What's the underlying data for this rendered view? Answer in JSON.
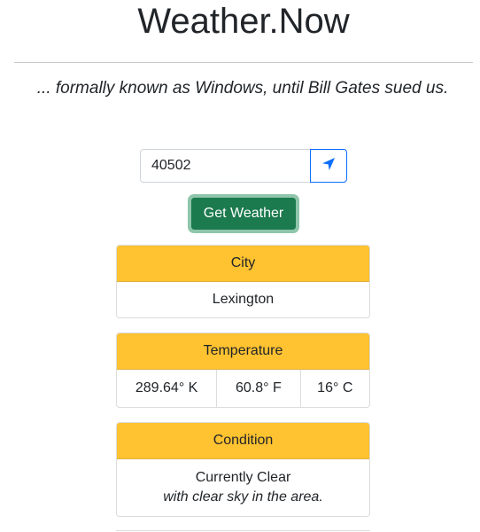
{
  "app": {
    "title": "Weather.Now",
    "tagline": "... formally known as Windows, until Bill Gates sued us."
  },
  "search": {
    "zip_value": "40502",
    "locate_icon": "location-arrow-icon",
    "button_label": "Get Weather"
  },
  "cards": {
    "city": {
      "header": "City",
      "value": "Lexington"
    },
    "temperature": {
      "header": "Temperature",
      "kelvin": "289.64° K",
      "fahrenheit": "60.8° F",
      "celsius": "16° C"
    },
    "condition": {
      "header": "Condition",
      "summary": "Currently Clear",
      "detail": "with clear sky in the area."
    }
  },
  "colors": {
    "card_header": "#ffc230",
    "button_green": "#1b7a4e",
    "accent_blue": "#0d6efd"
  }
}
